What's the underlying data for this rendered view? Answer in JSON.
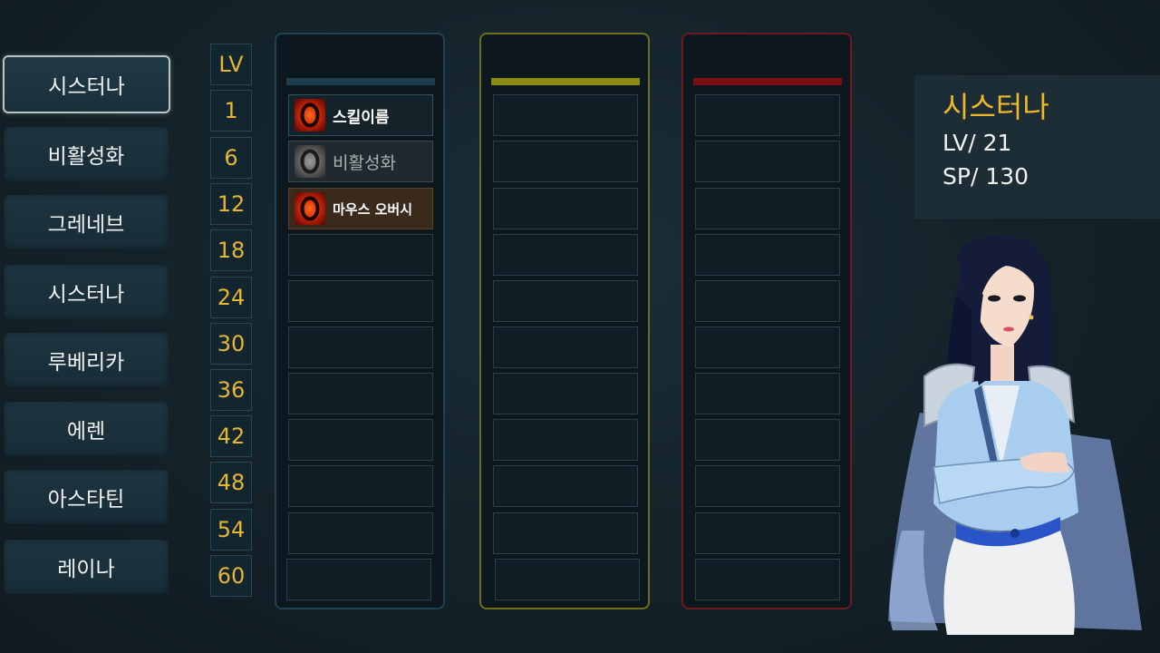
{
  "characters": [
    {
      "label": "시스터나",
      "selected": true
    },
    {
      "label": "비활성화",
      "selected": false
    },
    {
      "label": "그레네브",
      "selected": false
    },
    {
      "label": "시스터나",
      "selected": false
    },
    {
      "label": "루베리카",
      "selected": false
    },
    {
      "label": "에렌",
      "selected": false
    },
    {
      "label": "아스타틴",
      "selected": false
    },
    {
      "label": "레이나",
      "selected": false
    }
  ],
  "levels": {
    "header": "LV",
    "values": [
      "1",
      "6",
      "12",
      "18",
      "24",
      "30",
      "36",
      "42",
      "48",
      "54",
      "60"
    ]
  },
  "skill_columns": [
    {
      "name": "blue",
      "color": "#1f4256",
      "slots": [
        {
          "label": "스킬이름",
          "icon": "fire-ring-icon",
          "state": "active"
        },
        {
          "label": "비활성화",
          "icon": "grey-ring-icon",
          "state": "inactive"
        },
        {
          "label": "마우스 오버시",
          "icon": "fire-ring-icon",
          "state": "hover"
        }
      ]
    },
    {
      "name": "yellow",
      "color": "#8b8a15",
      "slots": []
    },
    {
      "name": "red",
      "color": "#7a0e12",
      "slots": []
    }
  ],
  "info": {
    "name": "시스터나",
    "level_text": "LV/ 21",
    "sp_text": "SP/ 130"
  },
  "colors": {
    "accent_gold": "#f0b82a",
    "level_gold": "#e6b532",
    "background": "#142229"
  }
}
